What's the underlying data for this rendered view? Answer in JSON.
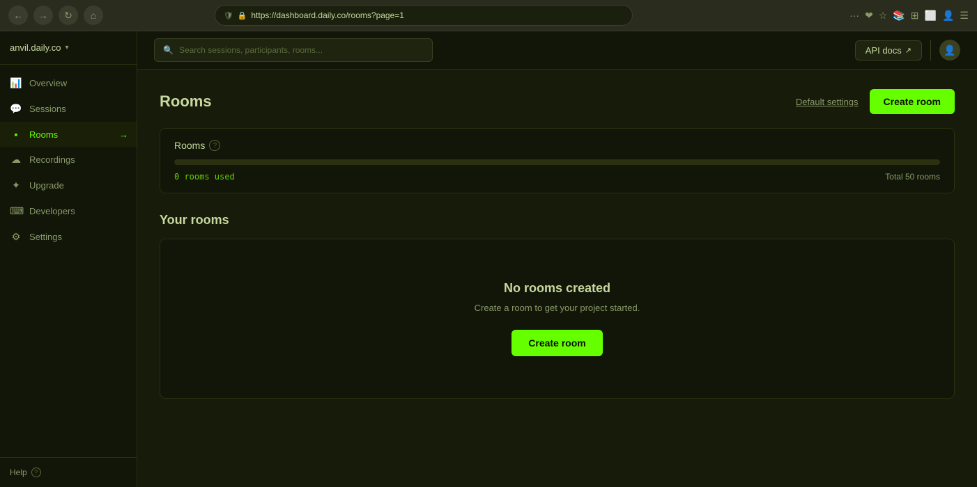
{
  "browser": {
    "url": "https://dashboard.daily.co/rooms?page=1",
    "nav": {
      "back": "←",
      "forward": "→",
      "refresh": "↺",
      "home": "⌂"
    },
    "icons": [
      "···",
      "❤",
      "★",
      "📚",
      "⊞",
      "⬜",
      "👤",
      "☰"
    ]
  },
  "sidebar": {
    "logo": "anvil.daily.co",
    "chevron": "▾",
    "items": [
      {
        "id": "overview",
        "label": "Overview",
        "icon": "📊",
        "active": false
      },
      {
        "id": "sessions",
        "label": "Sessions",
        "icon": "💬",
        "active": false
      },
      {
        "id": "rooms",
        "label": "Rooms",
        "icon": "🟩",
        "active": true
      },
      {
        "id": "recordings",
        "label": "Recordings",
        "icon": "☁",
        "active": false
      },
      {
        "id": "upgrade",
        "label": "Upgrade",
        "icon": "⭐",
        "active": false
      },
      {
        "id": "developers",
        "label": "Developers",
        "icon": "💻",
        "active": false
      },
      {
        "id": "settings",
        "label": "Settings",
        "icon": "⚙",
        "active": false
      }
    ],
    "footer": {
      "label": "Help",
      "icon": "?",
      "info_icon": "ⓘ"
    }
  },
  "topbar": {
    "search_placeholder": "Search sessions, participants, rooms...",
    "api_docs_label": "API docs",
    "api_docs_icon": "↗"
  },
  "main": {
    "page_title": "Rooms",
    "default_settings_label": "Default settings",
    "create_room_top_label": "Create room",
    "rooms_card": {
      "title": "Rooms",
      "rooms_used": "0 rooms used",
      "rooms_total": "Total 50 rooms",
      "progress_pct": 0
    },
    "your_rooms_title": "Your rooms",
    "empty_state": {
      "title": "No rooms created",
      "subtitle": "Create a room to get your project started.",
      "create_btn_label": "Create room"
    }
  },
  "colors": {
    "accent_green": "#66ff00",
    "bg_dark": "#111608",
    "bg_main": "#161b0a",
    "border": "#2a3010",
    "text_primary": "#c8d8a0",
    "text_secondary": "#8a9a6a",
    "text_mono": "#66cc00"
  }
}
